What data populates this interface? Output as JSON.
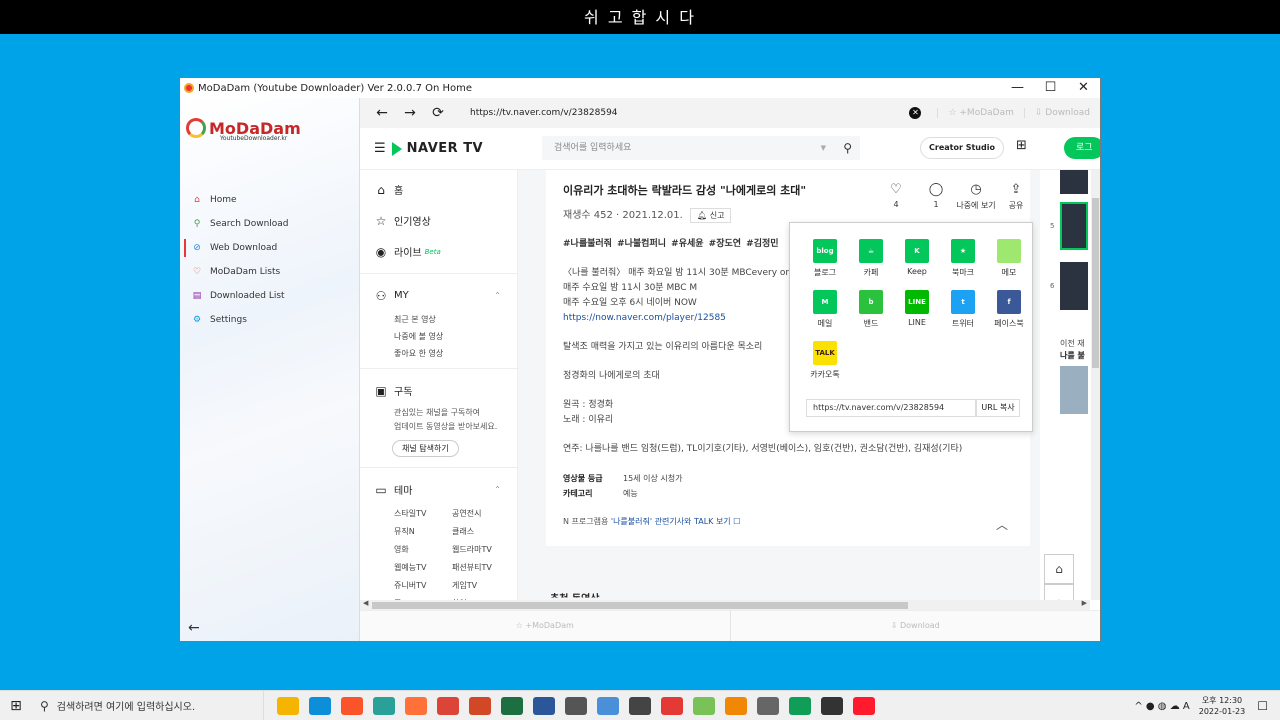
{
  "banner": {
    "text": "쉬 고 합 시 다"
  },
  "window": {
    "title": "MoDaDam (Youtube Downloader) Ver 2.0.0.7 On Home",
    "minimize": "—",
    "maximize": "☐",
    "close": "✕"
  },
  "sidebar": {
    "logo_text": "MoDaDam",
    "logo_sub": "YoutubeDownloader.kr",
    "items": [
      {
        "label": "Home",
        "icon": "home-icon",
        "glyph": "⌂",
        "color": "#e53935"
      },
      {
        "label": "Search Download",
        "icon": "search-icon",
        "glyph": "⚲",
        "color": "#43a047"
      },
      {
        "label": "Web Download",
        "icon": "globe-icon",
        "glyph": "⊘",
        "color": "#1e88e5"
      },
      {
        "label": "MoDaDam Lists",
        "icon": "heart-icon",
        "glyph": "♡",
        "color": "#e53935"
      },
      {
        "label": "Downloaded List",
        "icon": "folder-icon",
        "glyph": "▤",
        "color": "#8e24aa"
      },
      {
        "label": "Settings",
        "icon": "gear-icon",
        "glyph": "⚙",
        "color": "#039be5"
      }
    ],
    "back": "←"
  },
  "browser": {
    "url": "https://tv.naver.com/v/23828594",
    "modadam_btn": "☆ +MoDaDam",
    "download_btn": "⇩ Download"
  },
  "naver": {
    "logo": "NAVER TV",
    "search_placeholder": "검색어를 입력하세요",
    "creator_studio": "Creator Studio",
    "login": "로그",
    "menu": {
      "home": "홈",
      "popular": "인기영상",
      "live": "라이브",
      "live_beta": "Beta",
      "my": "MY",
      "my_items": [
        "최근 본 영상",
        "나중에 볼 영상",
        "좋아요 한 영상"
      ],
      "subscribe": "구독",
      "subscribe_desc": [
        "관심있는 채널을 구독하여",
        "업데이트 동영상을 받아보세요."
      ],
      "explore_btn": "채널 탐색하기",
      "theme": "테마",
      "themes": [
        "스타일TV",
        "공연전시",
        "뮤직N",
        "클래스",
        "영화",
        "웹드라마TV",
        "웹예능TV",
        "패션뷰티TV",
        "쥬니버TV",
        "게임TV",
        "푸드TV",
        "창업"
      ]
    }
  },
  "video": {
    "title": "이유리가 초대하는 락발라드 감성 \"나에게로의 초대\"",
    "meta": "재생수 452 · 2021.12.01.",
    "report": "신고",
    "actions": [
      {
        "icon": "heart-icon",
        "glyph": "♡",
        "label": "4"
      },
      {
        "icon": "comment-icon",
        "glyph": "◯",
        "label": "1"
      },
      {
        "icon": "clock-icon",
        "glyph": "◷",
        "label": "나중에 보기"
      },
      {
        "icon": "share-icon",
        "glyph": "⇪",
        "label": "공유"
      }
    ],
    "tags": "#나를불러줘 #나불컴퍼니 #유세윤 #장도연 #김정민",
    "desc_lines": [
      "〈나를 불러줘〉 매주 화요일 밤 11시 30분 MBCevery one",
      "매주 수요일 밤 11시 30분 MBC M",
      "매주 수요일 오후 6시 네이버 NOW"
    ],
    "link": "https://now.naver.com/player/12585",
    "para1": "탈색조 매력을 가지고 있는 이유리의 아름다운 목소리",
    "para2": "정경화의 나에게로의 초대",
    "original": "원곡 : 정경화",
    "singer": "노래 : 이유리",
    "performers": "연주: 나를나를 밴드 임청(드럼), TL이기호(기타), 서영빈(베이스), 임호(건반), 권소담(건반), 김재성(기타)",
    "rating_key": "영상물 등급",
    "rating_val": "15세 이상 시청가",
    "category_key": "카테고리",
    "category_val": "예능",
    "program_prefix": "N 프로그램용",
    "program_link": "'나를불러줘' 관련기사와 TALK 보기 ☐",
    "below_title": "추천 동영상"
  },
  "share": {
    "items": [
      {
        "label": "블로그",
        "icon": "blog-icon",
        "color": "#03c75a",
        "text": "blog"
      },
      {
        "label": "카페",
        "icon": "cafe-icon",
        "color": "#03c75a",
        "text": "☕"
      },
      {
        "label": "Keep",
        "icon": "keep-icon",
        "color": "#03c75a",
        "text": "K"
      },
      {
        "label": "북마크",
        "icon": "bookmark-icon",
        "color": "#03c75a",
        "text": "★"
      },
      {
        "label": "메모",
        "icon": "memo-icon",
        "color": "#9ee86f",
        "text": ""
      },
      {
        "label": "메일",
        "icon": "mail-icon",
        "color": "#03c75a",
        "text": "M"
      },
      {
        "label": "밴드",
        "icon": "band-icon",
        "color": "#2ac13d",
        "text": "b"
      },
      {
        "label": "LINE",
        "icon": "line-icon",
        "color": "#00b900",
        "text": "LINE"
      },
      {
        "label": "트위터",
        "icon": "twitter-icon",
        "color": "#1da1f2",
        "text": "t"
      },
      {
        "label": "페이스북",
        "icon": "facebook-icon",
        "color": "#3b5998",
        "text": "f"
      },
      {
        "label": "카카오톡",
        "icon": "kakaotalk-icon",
        "color": "#fae100",
        "text": "TALK"
      }
    ],
    "url": "https://tv.naver.com/v/23828594",
    "copy": "URL 복사"
  },
  "right_strip": {
    "num5": "5",
    "num6": "6",
    "prev_text": "이전 재",
    "prev_bold": "나를 불"
  },
  "bottom_bar": {
    "modadam": "☆ +MoDaDam",
    "download": "⇩ Download"
  },
  "taskbar": {
    "search_placeholder": "검색하려면 여기에 입력하십시오.",
    "icons": [
      {
        "icon": "file-explorer-icon",
        "color": "#f4b400"
      },
      {
        "icon": "edge-icon",
        "color": "#0c8fd8"
      },
      {
        "icon": "brave-icon",
        "color": "#fb542b"
      },
      {
        "icon": "app-icon",
        "color": "#2aa198"
      },
      {
        "icon": "firefox-icon",
        "color": "#ff7139"
      },
      {
        "icon": "chrome-icon",
        "color": "#db4437"
      },
      {
        "icon": "powerpoint-icon",
        "color": "#d24726"
      },
      {
        "icon": "excel-icon",
        "color": "#1d6f42"
      },
      {
        "icon": "word-icon",
        "color": "#2b579a"
      },
      {
        "icon": "terminal-icon",
        "color": "#555"
      },
      {
        "icon": "remote-icon",
        "color": "#4a90d9"
      },
      {
        "icon": "search-app-icon",
        "color": "#444"
      },
      {
        "icon": "se-app-icon",
        "color": "#e53935"
      },
      {
        "icon": "android-icon",
        "color": "#78c257"
      },
      {
        "icon": "vlc-icon",
        "color": "#f08705"
      },
      {
        "icon": "calculator-icon",
        "color": "#666"
      },
      {
        "icon": "chrome2-icon",
        "color": "#0f9d58"
      },
      {
        "icon": "dark-app-icon",
        "color": "#333"
      },
      {
        "icon": "opera-icon",
        "color": "#ff1b2d"
      }
    ],
    "tray": "^ ● ◍ ☁ A",
    "time": "오후 12:30",
    "date": "2022-01-23"
  }
}
